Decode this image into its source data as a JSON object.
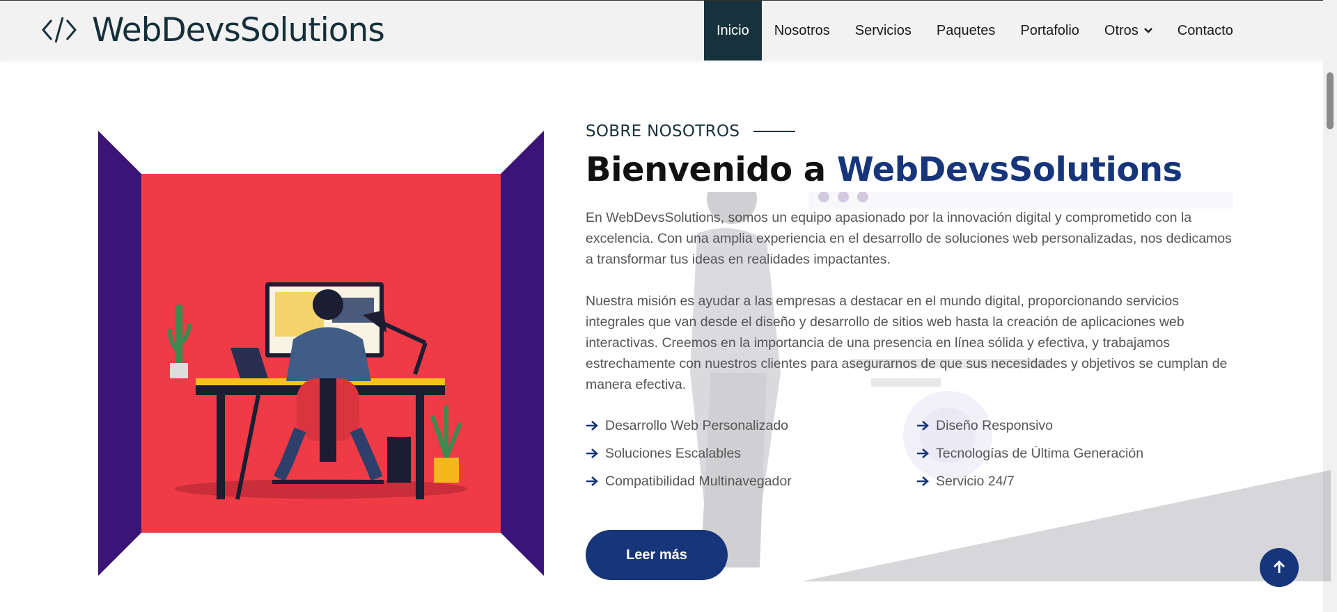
{
  "brand": {
    "name": "WebDevsSolutions",
    "icon": "code-brackets-icon",
    "color": "#16303a"
  },
  "nav": {
    "items": [
      {
        "label": "Inicio",
        "active": true
      },
      {
        "label": "Nosotros"
      },
      {
        "label": "Servicios"
      },
      {
        "label": "Paquetes"
      },
      {
        "label": "Portafolio"
      },
      {
        "label": "Otros",
        "icon": "chevron-down-icon"
      },
      {
        "label": "Contacto"
      }
    ],
    "active_color": "#17323c"
  },
  "about": {
    "eyebrow": "SOBRE NOSOTROS",
    "heading_prefix": "Bienvenido a ",
    "heading_brand": "WebDevsSolutions",
    "paragraphs": [
      "En WebDevsSolutions, somos un equipo apasionado por la innovación digital y comprometido con la excelencia. Con una amplia experiencia en el desarrollo de soluciones web personalizadas, nos dedicamos a transformar tus ideas en realidades impactantes.",
      "Nuestra misión es ayudar a las empresas a destacar en el mundo digital, proporcionando servicios integrales que van desde el diseño y desarrollo de sitios web hasta la creación de aplicaciones web interactivas. Creemos en la importancia de una presencia en línea sólida y efectiva, y trabajamos estrechamente con nuestros clientes para asegurarnos de que sus necesidades y objetivos se cumplan de manera efectiva."
    ],
    "features": [
      "Desarrollo Web Personalizado",
      "Diseño Responsivo",
      "Soluciones Escalables",
      "Tecnologías de Última Generación",
      "Compatibilidad Multinavegador",
      "Servicio 24/7"
    ],
    "feature_icon": "arrow-right-icon",
    "cta_label": "Leer más",
    "accent": "#17357a"
  },
  "illustration": {
    "frame_color": "#3b1478",
    "panel_color": "#ee3b45"
  },
  "scroll_top": {
    "icon": "arrow-up-icon"
  }
}
